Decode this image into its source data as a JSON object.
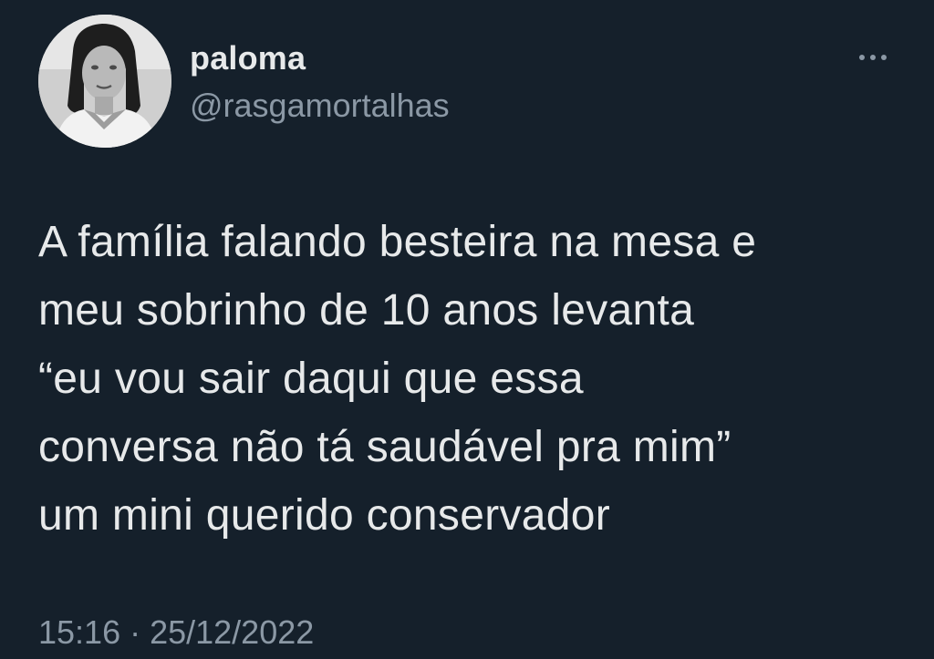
{
  "author": {
    "name": "paloma",
    "handle": "@rasgamortalhas",
    "avatar_icon": "profile-photo"
  },
  "menu": {
    "icon": "more-options-icon"
  },
  "tweet": {
    "lines": [
      "A família falando besteira na mesa e",
      "meu sobrinho de 10 anos levanta",
      "“eu vou sair daqui que essa",
      "conversa não tá saudável pra mim”",
      "um mini querido conservador"
    ],
    "time": "15:16",
    "separator": "·",
    "date": "25/12/2022"
  },
  "colors": {
    "background": "#15202b",
    "primary_text": "#e7e9ea",
    "secondary_text": "#8b98a5"
  }
}
